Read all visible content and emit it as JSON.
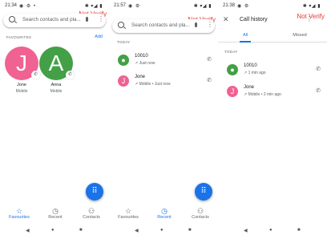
{
  "screens": [
    {
      "time": "21:34",
      "not_verify": "Not Verify",
      "search_placeholder": "Search contacts and pla...",
      "favourites_header": "FAVOURITES",
      "add_label": "Add",
      "favourites": [
        {
          "initial": "J",
          "name": "Jone",
          "type": "Mobile",
          "color": "#f06292"
        },
        {
          "initial": "A",
          "name": "Anna",
          "type": "Mobile",
          "color": "#43a047"
        }
      ],
      "bottom_nav": [
        {
          "icon": "☆",
          "label": "Favourites",
          "active": true
        },
        {
          "icon": "◷",
          "label": "Recent",
          "active": false
        },
        {
          "icon": "⚇",
          "label": "Contacts",
          "active": false
        }
      ]
    },
    {
      "time": "21:57",
      "not_verify": "Not Verify",
      "search_placeholder": "Search contacts and pla...",
      "today_header": "TODAY",
      "calls": [
        {
          "initial": "",
          "name": "10010",
          "detail": "↗ Just now",
          "color": "#43a047"
        },
        {
          "initial": "J",
          "name": "Jone",
          "detail": "↗ Mobile • Just now",
          "color": "#f06292"
        }
      ],
      "bottom_nav": [
        {
          "icon": "☆",
          "label": "Favourites",
          "active": false
        },
        {
          "icon": "◷",
          "label": "Recent",
          "active": true
        },
        {
          "icon": "⚇",
          "label": "Contacts",
          "active": false
        }
      ]
    },
    {
      "time": "21:38",
      "not_verify": "Not Verify",
      "title": "Call history",
      "tabs": [
        "All",
        "Missed"
      ],
      "today_header": "TODAY",
      "calls": [
        {
          "initial": "",
          "name": "10010",
          "detail": "↗ 1 min ago",
          "color": "#43a047"
        },
        {
          "initial": "J",
          "name": "Jone",
          "detail": "↗ Mobile • 2 min ago",
          "color": "#f06292"
        }
      ]
    }
  ],
  "colors": {
    "accent": "#1a73e8",
    "warning": "#e53935"
  }
}
